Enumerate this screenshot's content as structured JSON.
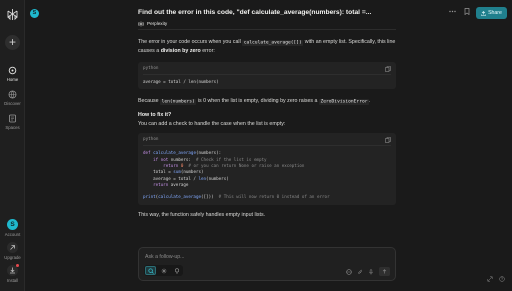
{
  "sidebar": {
    "items": [
      {
        "label": "Home",
        "icon": "home-search-icon"
      },
      {
        "label": "Discover",
        "icon": "globe-icon"
      },
      {
        "label": "Spaces",
        "icon": "spaces-icon"
      }
    ],
    "bottom": [
      {
        "label": "Account",
        "avatar_letter": "S"
      },
      {
        "label": "Upgrade",
        "icon": "upgrade-icon"
      },
      {
        "label": "Install",
        "icon": "download-icon"
      }
    ]
  },
  "topbar": {
    "avatar_letter": "S",
    "title": "Find out the error in this code, \"def calculate_average(numbers): total =...",
    "share_label": "Share",
    "accent": "#20808d"
  },
  "tab": {
    "label": "Perplexity"
  },
  "answer": {
    "p1_a": "The error in your code occurs when you call ",
    "p1_code": "calculate_average([])",
    "p1_b": " with an empty list. Specifically, this line causes a ",
    "p1_bold": "division by zero",
    "p1_c": " error:",
    "block1_lang": "python",
    "block1_code": "average = total / len(numbers)",
    "p2_a": "Because ",
    "p2_code1": "len(numbers)",
    "p2_b": " is 0 when the list is empty, dividing by zero raises a ",
    "p2_code2": "ZeroDivisionError",
    "p2_c": ".",
    "heading": "How to fix it?",
    "p3": "You can add a check to handle the case when the list is empty:",
    "block2_lang": "python",
    "block2_lines": [
      "def calculate_average(numbers):",
      "    if not numbers:  # Check if the list is empty",
      "        return 0  # or you can return None or raise an exception",
      "    total = sum(numbers)",
      "    average = total / len(numbers)",
      "    return average",
      "",
      "print(calculate_average([]))  # This will now return 0 instead of an error"
    ],
    "p4": "This way, the function safely handles empty input lists."
  },
  "composer": {
    "placeholder": "Ask a follow-up..."
  }
}
